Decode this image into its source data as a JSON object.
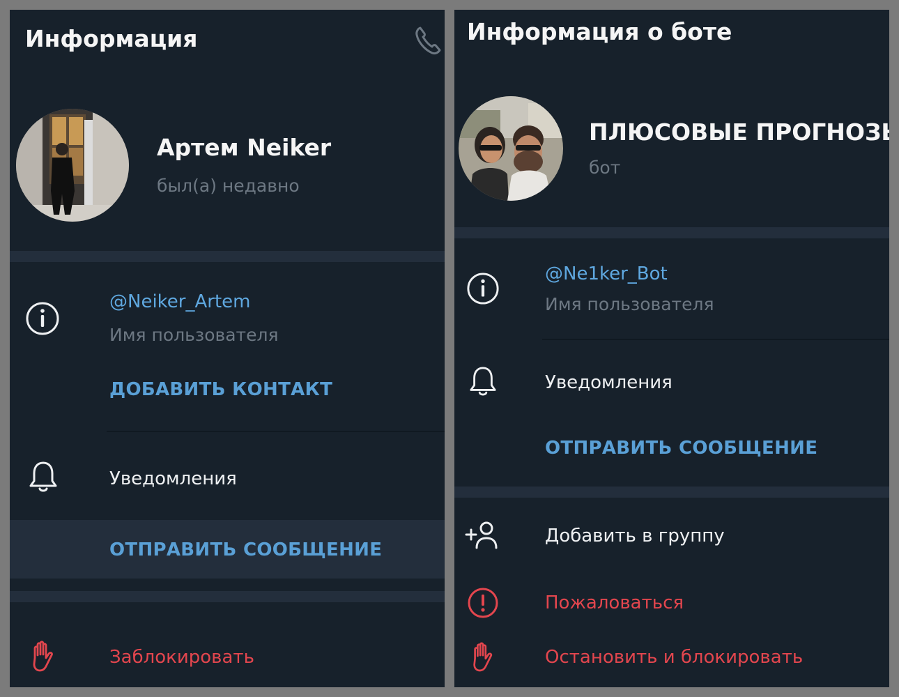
{
  "left": {
    "header_title": "Информация",
    "profile": {
      "name": "Артем Neiker",
      "status": "был(а) недавно"
    },
    "info": {
      "username": "@Neiker_Artem",
      "username_label": "Имя пользователя",
      "add_contact": "ДОБАВИТЬ КОНТАКТ"
    },
    "notifications_label": "Уведомления",
    "send_message": "ОТПРАВИТЬ СООБЩЕНИЕ",
    "block": "Заблокировать"
  },
  "right": {
    "header_title": "Информация о боте",
    "profile": {
      "name": "ПЛЮСОВЫЕ ПРОГНОЗЫ",
      "status": "бот"
    },
    "info": {
      "username": "@Ne1ker_Bot",
      "username_label": "Имя пользователя"
    },
    "notifications_label": "Уведомления",
    "send_message": "ОТПРАВИТЬ СООБЩЕНИЕ",
    "add_to_group": "Добавить в группу",
    "report": "Пожаловаться",
    "stop_and_block": "Остановить и блокировать"
  },
  "colors": {
    "panel_bg": "#17212b",
    "divider": "#232e3c",
    "accent_blue": "#5fa8e0",
    "danger_red": "#e3464e",
    "muted_text": "#6d7883"
  }
}
